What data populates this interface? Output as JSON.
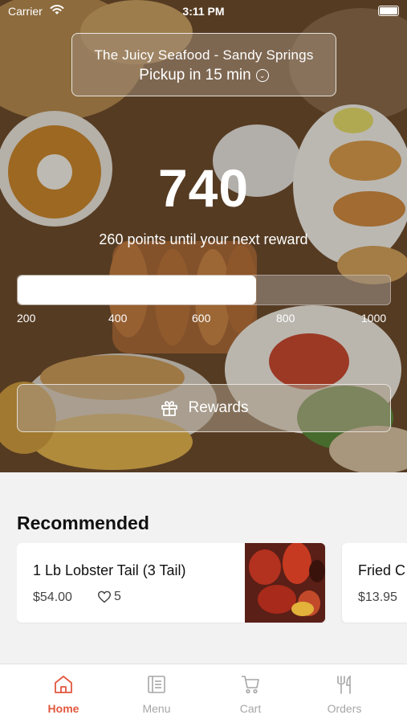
{
  "status_bar": {
    "carrier": "Carrier",
    "time": "3:11 PM"
  },
  "store": {
    "name": "The Juicy Seafood - Sandy Springs",
    "pickup": "Pickup in 15 min"
  },
  "rewards": {
    "points": "740",
    "until_text": "260 points until your next reward",
    "progress_fraction": 0.64,
    "ticks": [
      "200",
      "400",
      "600",
      "800",
      "1000"
    ],
    "button_label": "Rewards"
  },
  "recommended": {
    "title": "Recommended",
    "items": [
      {
        "name": "1 Lb Lobster Tail (3 Tail)",
        "price": "$54.00",
        "likes": "5"
      },
      {
        "name": "Fried C",
        "price": "$13.95"
      }
    ]
  },
  "tabs": [
    {
      "label": "Home",
      "icon": "home-icon",
      "active": true
    },
    {
      "label": "Menu",
      "icon": "menu-icon",
      "active": false
    },
    {
      "label": "Cart",
      "icon": "cart-icon",
      "active": false
    },
    {
      "label": "Orders",
      "icon": "fork-knife-icon",
      "active": false
    }
  ],
  "colors": {
    "accent": "#e1583e",
    "tab_inactive": "#a6a6a6"
  }
}
